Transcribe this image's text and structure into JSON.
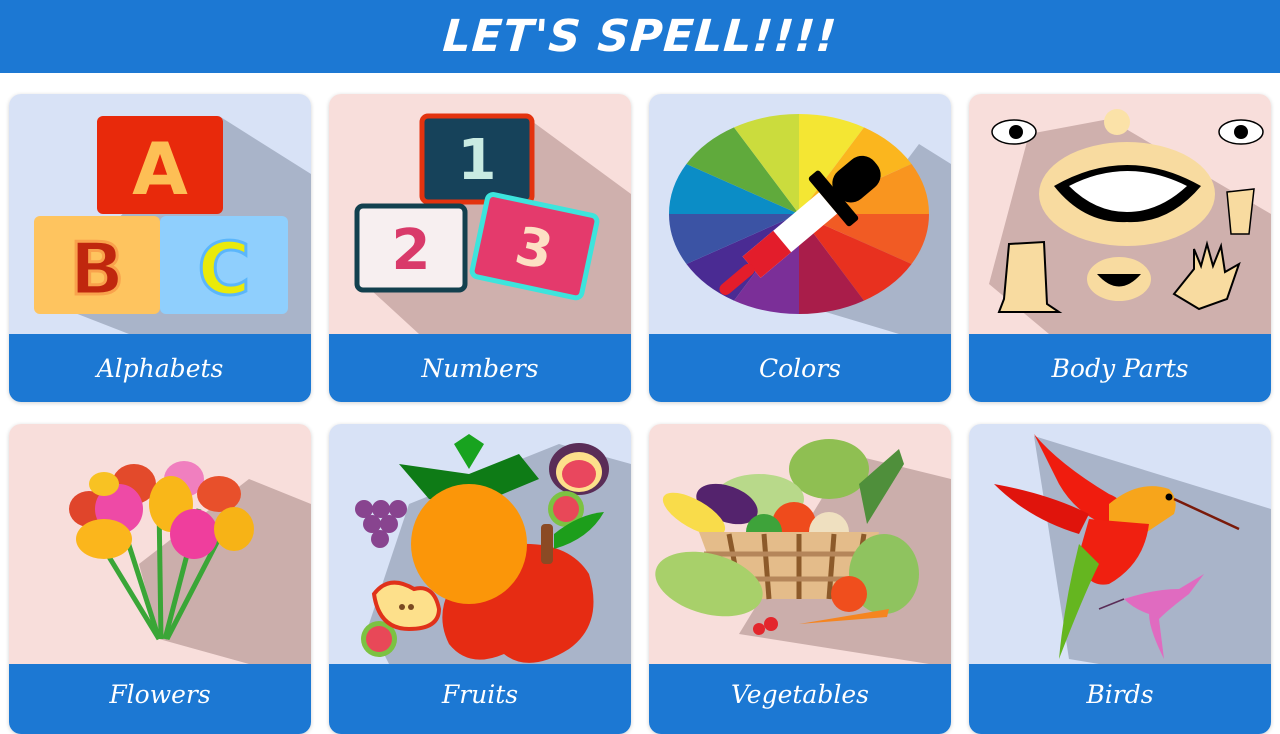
{
  "header": {
    "title": "LET'S SPELL!!!!"
  },
  "colors": {
    "header_bg": "#1c78d3",
    "label_bg": "#1c78d3",
    "card_bg_blue": "#d8e2f6",
    "card_bg_pink": "#f8dedb"
  },
  "categories": [
    {
      "label": "Alphabets",
      "icon": "abc-blocks-icon"
    },
    {
      "label": "Numbers",
      "icon": "number-blocks-icon"
    },
    {
      "label": "Colors",
      "icon": "color-wheel-dropper-icon"
    },
    {
      "label": "Body Parts",
      "icon": "body-parts-icon"
    },
    {
      "label": "Flowers",
      "icon": "tulip-bouquet-icon"
    },
    {
      "label": "Fruits",
      "icon": "fruits-icon"
    },
    {
      "label": "Vegetables",
      "icon": "vegetable-basket-icon"
    },
    {
      "label": "Birds",
      "icon": "hummingbird-icon"
    }
  ],
  "block_letters": [
    "A",
    "B",
    "C"
  ],
  "block_numbers": [
    "1",
    "2",
    "3"
  ]
}
